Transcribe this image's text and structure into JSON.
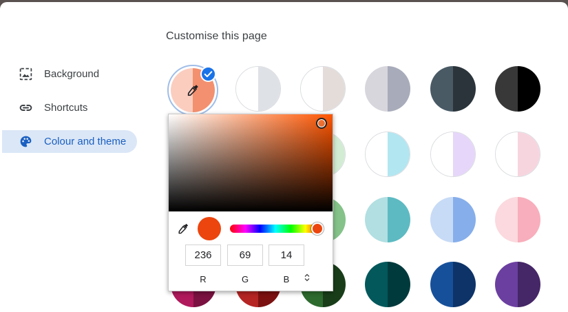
{
  "page": {
    "title": "Customise this page"
  },
  "sidebar": {
    "items": [
      {
        "label": "Background",
        "icon": "image-icon",
        "active": false
      },
      {
        "label": "Shortcuts",
        "icon": "link-icon",
        "active": false
      },
      {
        "label": "Colour and theme",
        "icon": "palette-icon",
        "active": true
      }
    ]
  },
  "picker": {
    "r": "236",
    "g": "69",
    "b": "14",
    "r_label": "R",
    "g_label": "G",
    "b_label": "B",
    "current_color": "#ec450e",
    "hue_color": "#ff5500",
    "hue_fraction": 0.96
  },
  "colors": {
    "accent": "#1a73e8",
    "active_nav_bg": "#dbe7f7",
    "custom_left": "#fbcdbf",
    "custom_right": "#f3906f"
  },
  "swatches": [
    [
      "#ffffff",
      "#dee1e6"
    ],
    [
      "#ffffff",
      "#e3dcd9"
    ],
    [
      "#d6d6dc",
      "#a8abba"
    ],
    [
      "#495a65",
      "#2b343b"
    ],
    [
      "#383838",
      "#000000"
    ],
    [
      "#ffffff",
      "#d2ecd3"
    ],
    [
      "#ffffff",
      "#b2e6f1"
    ],
    [
      "#ffffff",
      "#e6d6fa"
    ],
    [
      "#ffffff",
      "#f7d5df"
    ],
    [
      "#ffffff",
      "#84c289"
    ],
    [
      "#b1dfe2",
      "#5dbac2"
    ],
    [
      "#c7dbf6",
      "#86aeea"
    ],
    [
      "#fbd9de",
      "#f8aebc"
    ],
    [
      "#b0195c",
      "#7a1140"
    ],
    [
      "#b42524",
      "#7c1111"
    ],
    [
      "#2d6a2e",
      "#193d19"
    ],
    [
      "#02585b",
      "#003a3d"
    ],
    [
      "#17509a",
      "#0d3368"
    ],
    [
      "#6b3fa0",
      "#452667"
    ]
  ]
}
